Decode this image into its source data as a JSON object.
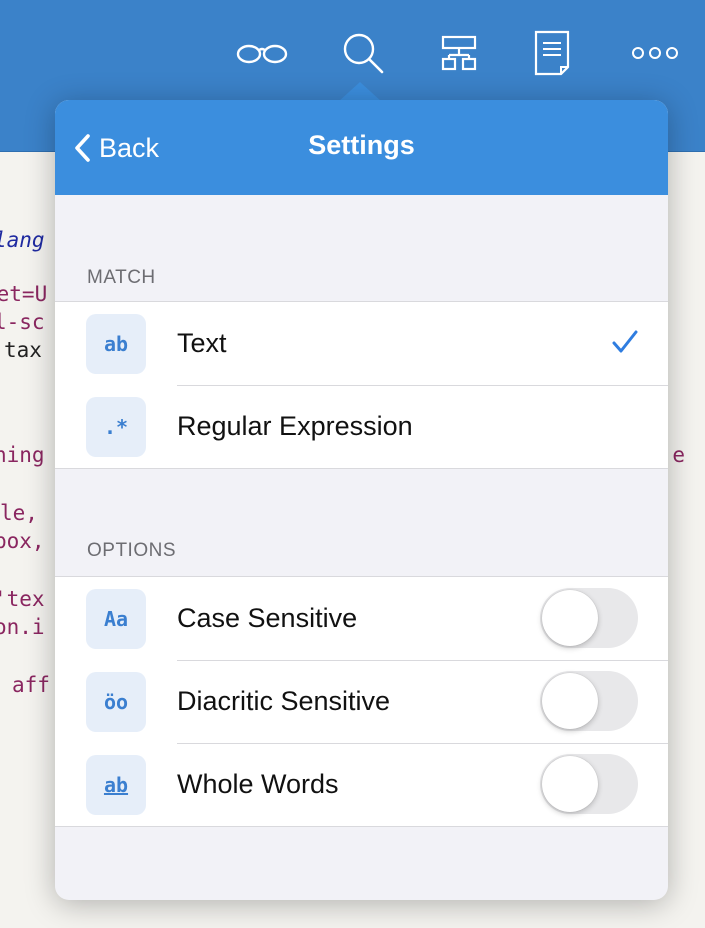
{
  "toolbar": {
    "icons": [
      "glasses-icon",
      "search-icon",
      "outline-tree-icon",
      "document-icon",
      "more-icon"
    ],
    "accent": "#3b82c9"
  },
  "editor_fragments": [
    {
      "text": "lang",
      "color": "#1f2aa0",
      "italic": true
    },
    {
      "text": "set=U",
      "color": "#8a2660"
    },
    {
      "text": "l-sc",
      "color": "#8a2660"
    },
    {
      "text": "tax",
      "color": "#222222"
    },
    {
      "text": "hing",
      "color": "#8a2660"
    },
    {
      "text": "le,",
      "color": "#8a2660"
    },
    {
      "text": "box,",
      "color": "#8a2660"
    },
    {
      "text": "'tex",
      "color": "#8a2660"
    },
    {
      "text": "on.i",
      "color": "#8a2660"
    },
    {
      "text": "aff",
      "color": "#8a2660"
    }
  ],
  "editor_right_fragment": "e",
  "popover": {
    "nav": {
      "back_label": "Back",
      "title": "Settings",
      "color": "#3b8ede"
    },
    "match": {
      "header": "MATCH",
      "items": [
        {
          "icon": "ab",
          "label": "Text",
          "selected": true
        },
        {
          "icon": ".*",
          "label": "Regular Expression",
          "selected": false
        }
      ]
    },
    "options": {
      "header": "OPTIONS",
      "items": [
        {
          "icon": "Aa",
          "label": "Case Sensitive",
          "enabled": false
        },
        {
          "icon": "öo",
          "label": "Diacritic Sensitive",
          "enabled": false
        },
        {
          "icon": "ab",
          "label": "Whole Words",
          "enabled": false
        }
      ]
    },
    "checkmark_color": "#2f7de0"
  }
}
